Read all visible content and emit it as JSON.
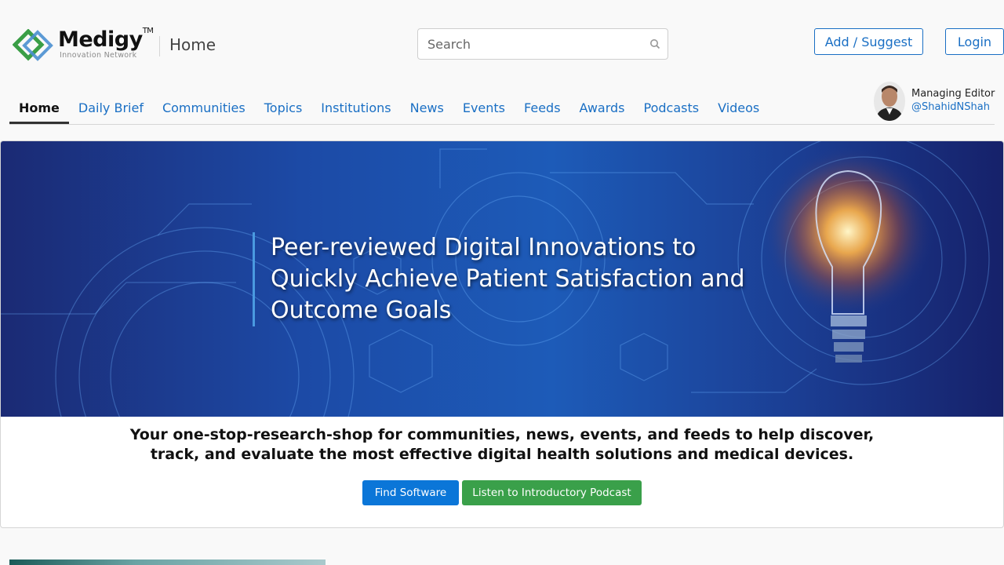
{
  "logo": {
    "name": "Medigy",
    "tm": "TM",
    "tagline": "Innovation Network"
  },
  "header": {
    "page_title": "Home",
    "search_placeholder": "Search",
    "add_suggest_label": "Add / Suggest",
    "login_label": "Login"
  },
  "nav": {
    "items": [
      {
        "label": "Home",
        "active": true
      },
      {
        "label": "Daily Brief"
      },
      {
        "label": "Communities"
      },
      {
        "label": "Topics"
      },
      {
        "label": "Institutions"
      },
      {
        "label": "News"
      },
      {
        "label": "Events"
      },
      {
        "label": "Feeds"
      },
      {
        "label": "Awards"
      },
      {
        "label": "Podcasts"
      },
      {
        "label": "Videos"
      }
    ]
  },
  "editor": {
    "role": "Managing Editor",
    "handle": "@ShahidNShah"
  },
  "hero": {
    "headline": "Peer-reviewed Digital Innovations to Quickly Achieve Patient Satisfaction and Outcome Goals",
    "tagline": "Your one-stop-research-shop for communities, news, events, and feeds to help discover, track, and evaluate the most effective digital health solutions and medical devices.",
    "find_software_label": "Find Software",
    "podcast_label": "Listen to Introductory Podcast"
  },
  "colors": {
    "link": "#1a6fc4",
    "primary_button": "#0b76d8",
    "success_button": "#3aa04a"
  },
  "icons": [
    "search-icon",
    "medigy-logo-icon",
    "lightbulb-icon"
  ]
}
